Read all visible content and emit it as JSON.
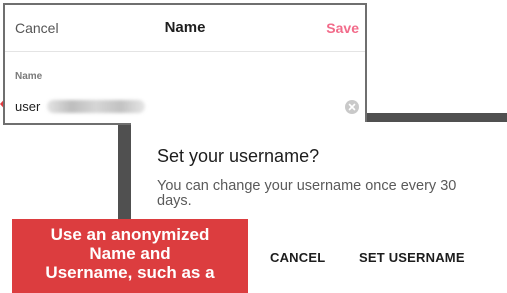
{
  "name_panel": {
    "cancel_label": "Cancel",
    "title": "Name",
    "save_label": "Save",
    "field_label": "Name",
    "field_value": "user",
    "clear_icon": "clear-circle-icon"
  },
  "dialog": {
    "title": "Set your username?",
    "message": "You can change your username once every 30 days.",
    "cancel_label": "CANCEL",
    "confirm_label": "SET USERNAME"
  },
  "annotation": {
    "lines": [
      "Use an anonymized",
      "Name and",
      "Username, such as a"
    ]
  },
  "colors": {
    "accent_save": "#f26b8a",
    "annotation_red": "#dc3d3f",
    "frame_dark": "#505050"
  }
}
